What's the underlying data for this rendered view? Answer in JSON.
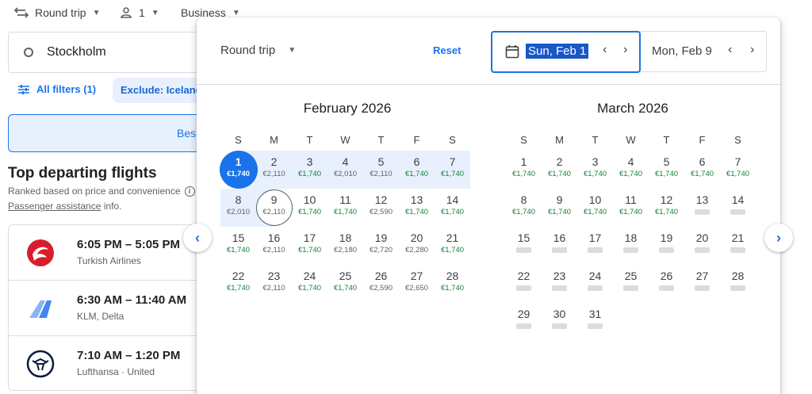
{
  "topbar": {
    "trip_type": "Round trip",
    "passengers": "1",
    "cabin": "Business"
  },
  "search": {
    "origin": "Stockholm"
  },
  "filters": {
    "all_filters": "All filters (1)",
    "exclude_chip": "Exclude: Iceland"
  },
  "tabs": {
    "best": "Bes"
  },
  "results": {
    "title": "Top departing flights",
    "ranked_note": "Ranked based on price and convenience",
    "assistance_link": "Passenger assistance",
    "assistance_suffix": " info.",
    "flights": [
      {
        "time": "6:05 PM – 5:05 PM",
        "airline": "Turkish Airlines",
        "logo": "turkish-airlines-logo"
      },
      {
        "time": "6:30 AM – 11:40 AM",
        "airline": "KLM, Delta",
        "logo": "klm-delta-logo"
      },
      {
        "time": "7:10 AM – 1:20 PM",
        "airline": "Lufthansa · United",
        "logo": "lufthansa-logo"
      }
    ]
  },
  "picker": {
    "trip_type": "Round trip",
    "reset": "Reset",
    "depart_date": "Sun, Feb 1",
    "return_date": "Mon, Feb 9",
    "weekday_headers": [
      "S",
      "M",
      "T",
      "W",
      "T",
      "F",
      "S"
    ],
    "price_color_low": "#188038",
    "selected_color": "#1a73e8",
    "months": [
      {
        "title": "February 2026",
        "start_weekday": 0,
        "days": [
          {
            "d": "1",
            "p": "€1,740",
            "c": "sel"
          },
          {
            "d": "2",
            "p": "€2,110",
            "c": "g"
          },
          {
            "d": "3",
            "p": "€1,740",
            "c": "green"
          },
          {
            "d": "4",
            "p": "€2,010",
            "c": "g"
          },
          {
            "d": "5",
            "p": "€2,110",
            "c": "g"
          },
          {
            "d": "6",
            "p": "€1,740",
            "c": "green"
          },
          {
            "d": "7",
            "p": "€1,740",
            "c": "green"
          },
          {
            "d": "8",
            "p": "€2,010",
            "c": "g"
          },
          {
            "d": "9",
            "p": "€2,110",
            "c": "ret"
          },
          {
            "d": "10",
            "p": "€1,740",
            "c": "green"
          },
          {
            "d": "11",
            "p": "€1,740",
            "c": "green"
          },
          {
            "d": "12",
            "p": "€2,590",
            "c": "g"
          },
          {
            "d": "13",
            "p": "€1,740",
            "c": "green"
          },
          {
            "d": "14",
            "p": "€1,740",
            "c": "green"
          },
          {
            "d": "15",
            "p": "€1,740",
            "c": "green"
          },
          {
            "d": "16",
            "p": "€2,110",
            "c": "g"
          },
          {
            "d": "17",
            "p": "€1,740",
            "c": "green"
          },
          {
            "d": "18",
            "p": "€2,180",
            "c": "g"
          },
          {
            "d": "19",
            "p": "€2,720",
            "c": "g"
          },
          {
            "d": "20",
            "p": "€2,280",
            "c": "g"
          },
          {
            "d": "21",
            "p": "€1,740",
            "c": "green"
          },
          {
            "d": "22",
            "p": "€1,740",
            "c": "green"
          },
          {
            "d": "23",
            "p": "€2,110",
            "c": "g"
          },
          {
            "d": "24",
            "p": "€1,740",
            "c": "green"
          },
          {
            "d": "25",
            "p": "€1,740",
            "c": "green"
          },
          {
            "d": "26",
            "p": "€2,590",
            "c": "g"
          },
          {
            "d": "27",
            "p": "€2,650",
            "c": "g"
          },
          {
            "d": "28",
            "p": "€1,740",
            "c": "green"
          }
        ]
      },
      {
        "title": "March 2026",
        "start_weekday": 0,
        "days": [
          {
            "d": "1",
            "p": "€1,740",
            "c": "green"
          },
          {
            "d": "2",
            "p": "€1,740",
            "c": "green"
          },
          {
            "d": "3",
            "p": "€1,740",
            "c": "green"
          },
          {
            "d": "4",
            "p": "€1,740",
            "c": "green"
          },
          {
            "d": "5",
            "p": "€1,740",
            "c": "green"
          },
          {
            "d": "6",
            "p": "€1,740",
            "c": "green"
          },
          {
            "d": "7",
            "p": "€1,740",
            "c": "green"
          },
          {
            "d": "8",
            "p": "€1,740",
            "c": "green"
          },
          {
            "d": "9",
            "p": "€1,740",
            "c": "green"
          },
          {
            "d": "10",
            "p": "€1,740",
            "c": "green"
          },
          {
            "d": "11",
            "p": "€1,740",
            "c": "green"
          },
          {
            "d": "12",
            "p": "€1,740",
            "c": "green"
          },
          {
            "d": "13",
            "p": "",
            "c": "grey"
          },
          {
            "d": "14",
            "p": "",
            "c": "grey"
          },
          {
            "d": "15",
            "p": "",
            "c": "grey"
          },
          {
            "d": "16",
            "p": "",
            "c": "grey"
          },
          {
            "d": "17",
            "p": "",
            "c": "grey"
          },
          {
            "d": "18",
            "p": "",
            "c": "grey"
          },
          {
            "d": "19",
            "p": "",
            "c": "grey"
          },
          {
            "d": "20",
            "p": "",
            "c": "grey"
          },
          {
            "d": "21",
            "p": "",
            "c": "grey"
          },
          {
            "d": "22",
            "p": "",
            "c": "grey"
          },
          {
            "d": "23",
            "p": "",
            "c": "grey"
          },
          {
            "d": "24",
            "p": "",
            "c": "grey"
          },
          {
            "d": "25",
            "p": "",
            "c": "grey"
          },
          {
            "d": "26",
            "p": "",
            "c": "grey"
          },
          {
            "d": "27",
            "p": "",
            "c": "grey"
          },
          {
            "d": "28",
            "p": "",
            "c": "grey"
          },
          {
            "d": "29",
            "p": "",
            "c": "grey"
          },
          {
            "d": "30",
            "p": "",
            "c": "grey"
          },
          {
            "d": "31",
            "p": "",
            "c": "grey"
          }
        ]
      }
    ]
  }
}
